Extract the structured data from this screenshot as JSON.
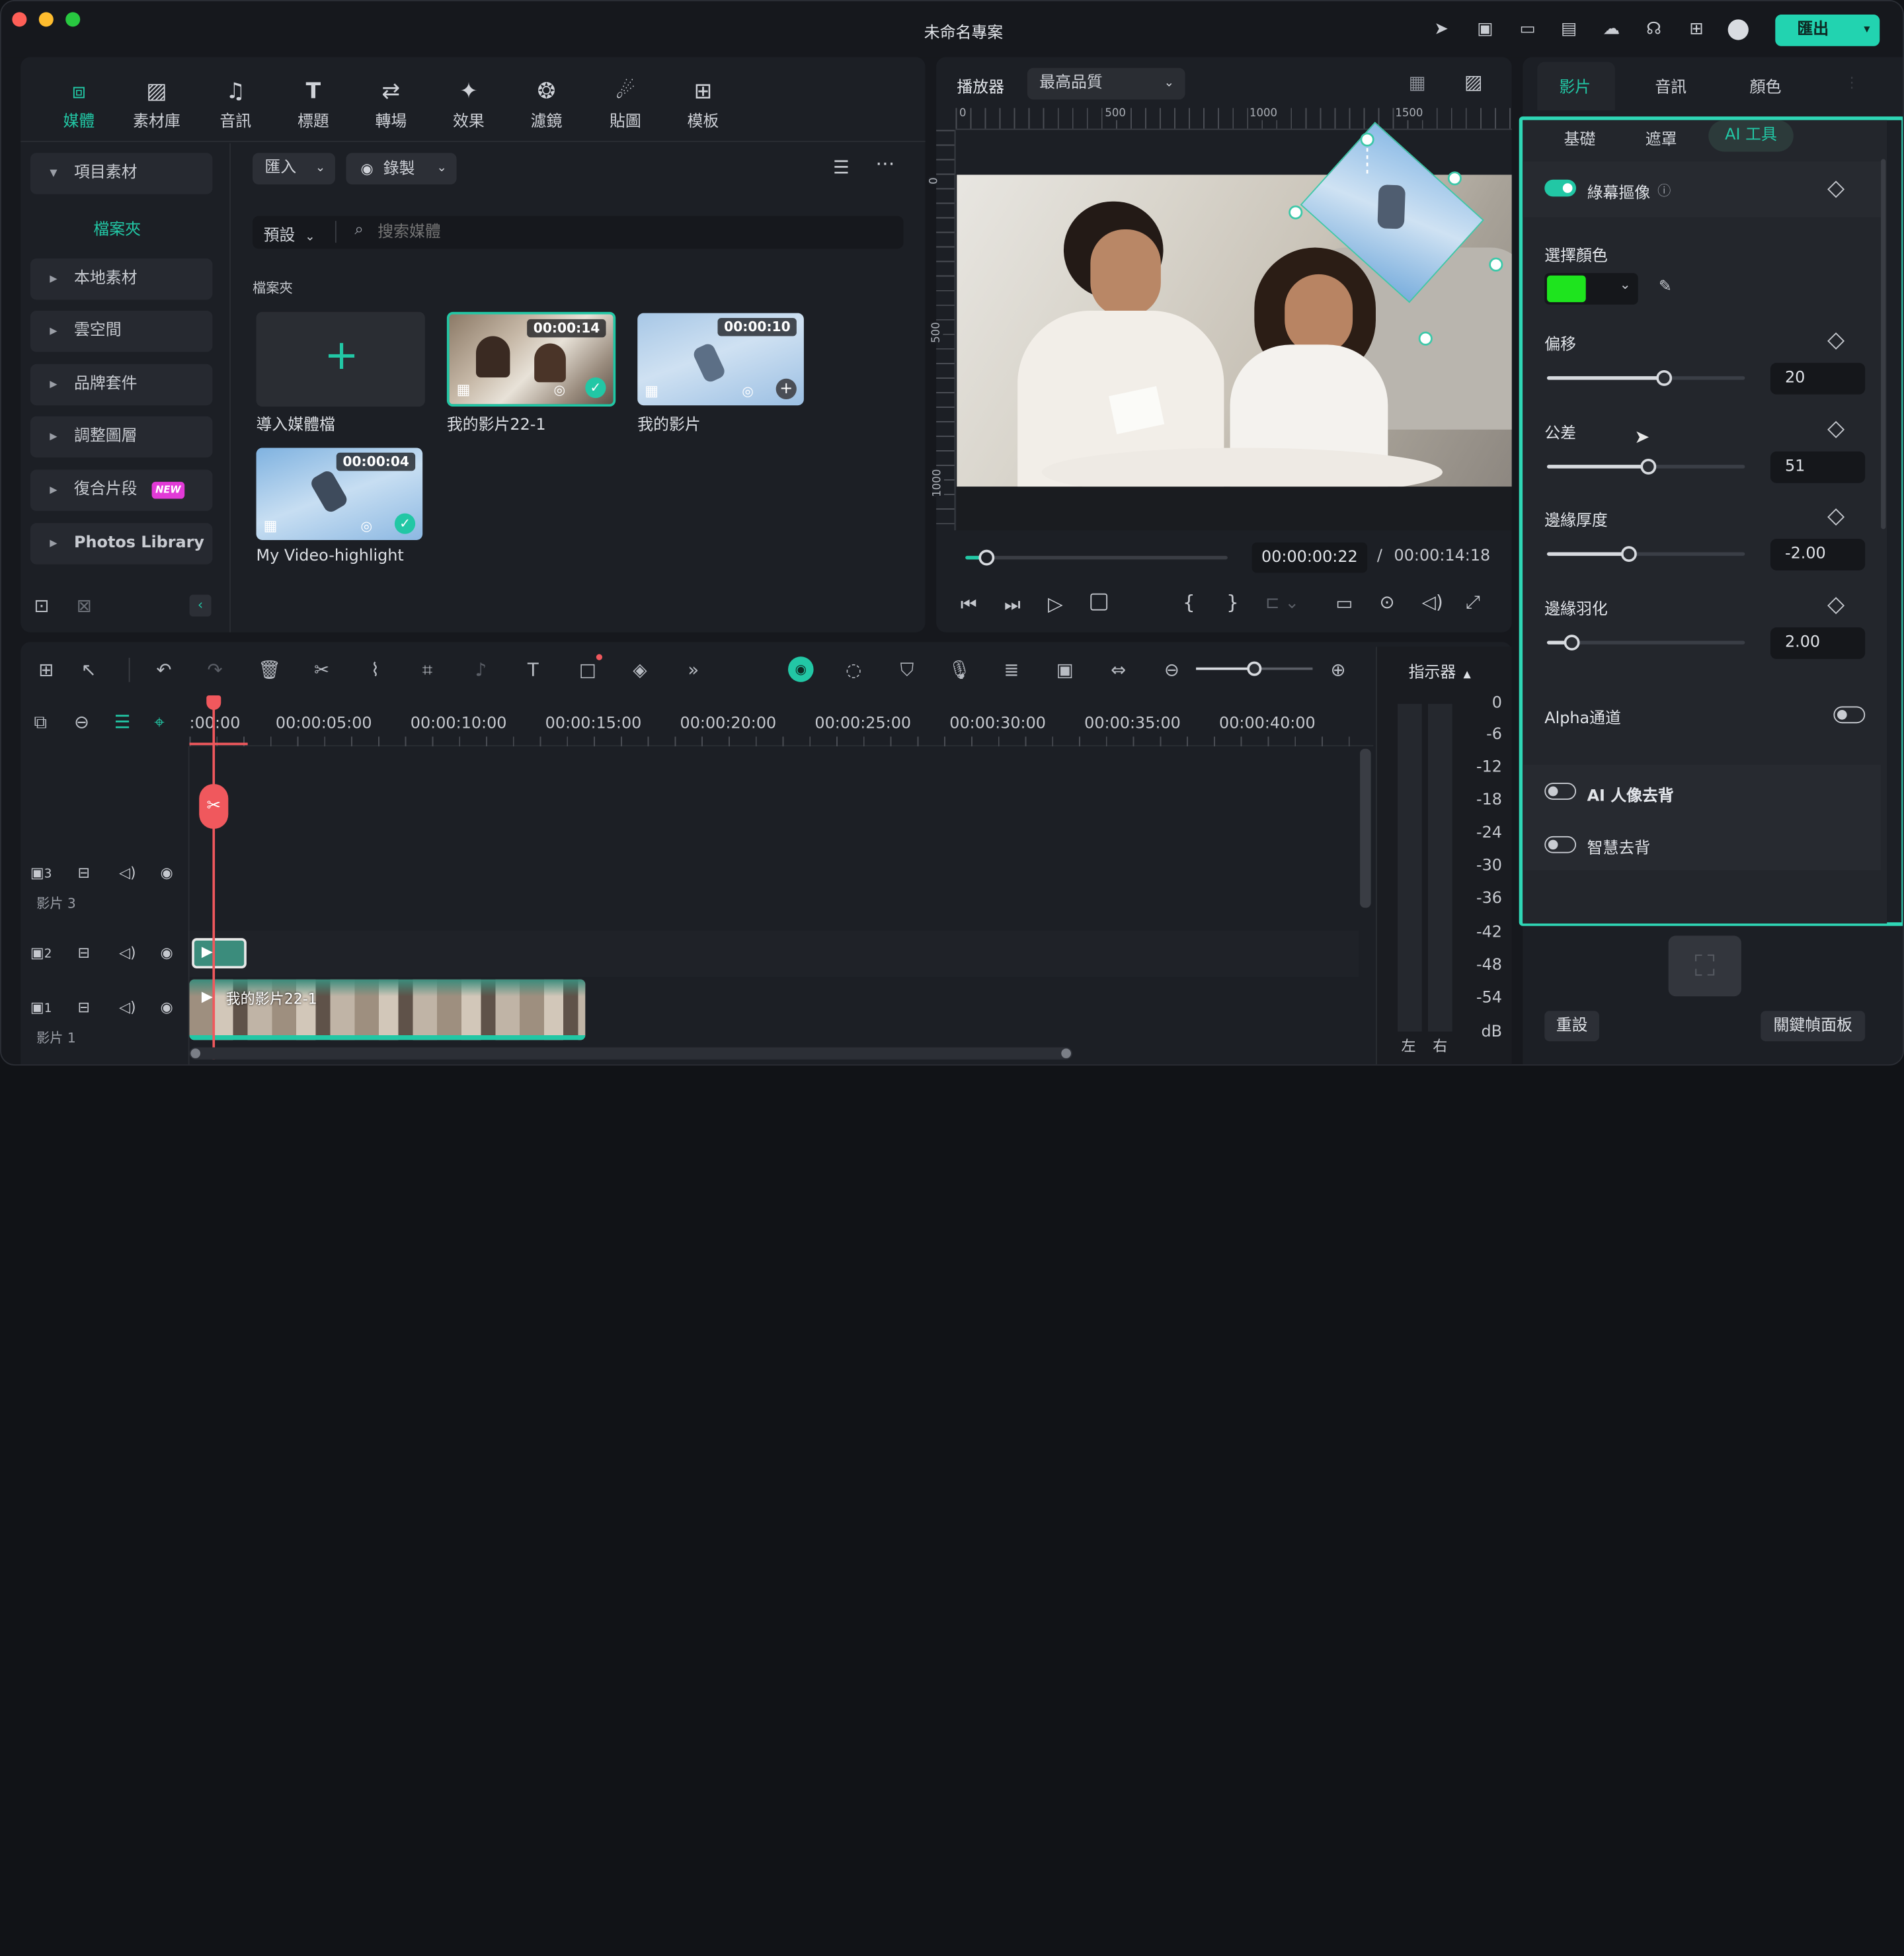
{
  "window": {
    "title": "未命名專案",
    "export_label": "匯出"
  },
  "colors": {
    "accent": "#22c7a5",
    "green_swatch": "#1ee41e",
    "playhead": "#f0585d",
    "panel": "#1f2228"
  },
  "media_toolbar": {
    "items": [
      {
        "label": "媒體",
        "icon": "media-icon"
      },
      {
        "label": "素材庫",
        "icon": "library-icon"
      },
      {
        "label": "音訊",
        "icon": "music-icon"
      },
      {
        "label": "標題",
        "icon": "title-icon"
      },
      {
        "label": "轉場",
        "icon": "transition-icon"
      },
      {
        "label": "效果",
        "icon": "effects-icon"
      },
      {
        "label": "濾鏡",
        "icon": "filter-icon"
      },
      {
        "label": "貼圖",
        "icon": "sticker-icon"
      },
      {
        "label": "模板",
        "icon": "template-icon"
      }
    ]
  },
  "sidebar": {
    "project_media": "項目素材",
    "folder": "檔案夾",
    "items": [
      "本地素材",
      "雲空間",
      "品牌套件",
      "調整圖層",
      "復合片段",
      "Photos Library"
    ],
    "new_badge": "NEW"
  },
  "media_panel": {
    "import_label": "匯入",
    "record_label": "錄製",
    "preset_label": "預設",
    "search_placeholder": "搜索媒體",
    "folder_label": "檔案夾",
    "import_tile_label": "導入媒體檔",
    "clips": [
      {
        "name": "我的影片22-1",
        "duration": "00:00:14"
      },
      {
        "name": "我的影片",
        "duration": "00:00:10"
      },
      {
        "name": "My Video-highlight",
        "duration": "00:00:04"
      }
    ]
  },
  "player": {
    "label": "播放器",
    "quality": "最高品質",
    "ruler_top": [
      "0",
      "500",
      "1000",
      "1500"
    ],
    "ruler_left": [
      "0",
      "500",
      "1000"
    ],
    "current_time": "00:00:00:22",
    "separator": "/",
    "total_time": "00:00:14:18",
    "progress": 0.08
  },
  "right_panel": {
    "tabs": [
      "影片",
      "音訊",
      "顏色"
    ],
    "subtabs": [
      "基礎",
      "遮罩",
      "AI 工具"
    ],
    "chroma_key": "綠幕摳像",
    "select_color": "選擇顏色",
    "params": [
      {
        "label": "偏移",
        "value": "20",
        "level": 0.59
      },
      {
        "label": "公差",
        "value": "51",
        "level": 0.51
      },
      {
        "label": "邊緣厚度",
        "value": "-2.00",
        "level": 0.41
      },
      {
        "label": "邊緣羽化",
        "value": "2.00",
        "level": 0.12
      }
    ],
    "alpha_channel": "Alpha通道",
    "ai_portrait": "AI 人像去背",
    "smart_cutout": "智慧去背",
    "reset_label": "重設",
    "keyframe_label": "關鍵幀面板"
  },
  "timeline": {
    "ruler": ":00:00",
    "ticks": [
      "00:00:05:00",
      "00:00:10:00",
      "00:00:15:00",
      "00:00:20:00",
      "00:00:25:00",
      "00:00:30:00",
      "00:00:35:00",
      "00:00:40:00"
    ],
    "meter_label": "指示器",
    "db_scale": [
      "0",
      "-6",
      "-12",
      "-18",
      "-24",
      "-30",
      "-36",
      "-42",
      "-48",
      "-54",
      "dB"
    ],
    "channels": [
      "左",
      "右"
    ],
    "tracks": [
      {
        "num": "3",
        "name": "影片 3"
      },
      {
        "num": "2",
        "name": ""
      },
      {
        "num": "1",
        "name": "影片 1"
      }
    ],
    "clip_name": "我的影片22-1"
  }
}
